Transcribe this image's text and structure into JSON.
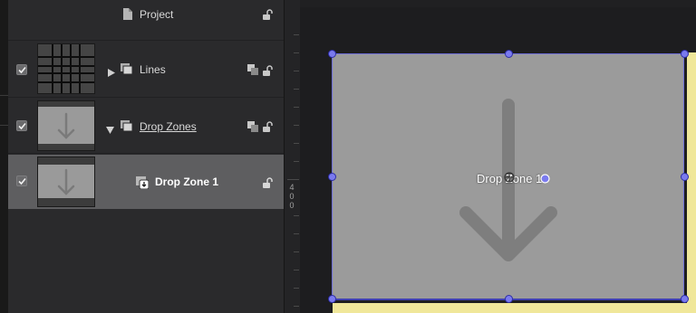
{
  "layers": {
    "project": {
      "label": "Project",
      "icon": "document-icon",
      "lock_icon": "unlock-icon"
    },
    "items": [
      {
        "label": "Lines",
        "checked": true,
        "disclosure": "collapsed",
        "icon": "group-icon",
        "thumbnail": "grid-lines-thumbnail"
      },
      {
        "label": "Drop Zones",
        "checked": true,
        "disclosure": "expanded",
        "icon": "group-icon",
        "underlined": true,
        "thumbnail": "drop-zone-thumbnail"
      },
      {
        "label": "Drop Zone 1",
        "checked": true,
        "selected": true,
        "icon": "drop-zone-icon",
        "thumbnail": "drop-zone-thumbnail"
      }
    ]
  },
  "ruler": {
    "label": "400",
    "digits": [
      "4",
      "0",
      "0"
    ]
  },
  "canvas": {
    "drop_zone_label": "Drop Zone 1",
    "drop_zone_fill": "#9b9b9b",
    "handle_color": "#7a7aee",
    "guide_color": "#f0e79a"
  }
}
